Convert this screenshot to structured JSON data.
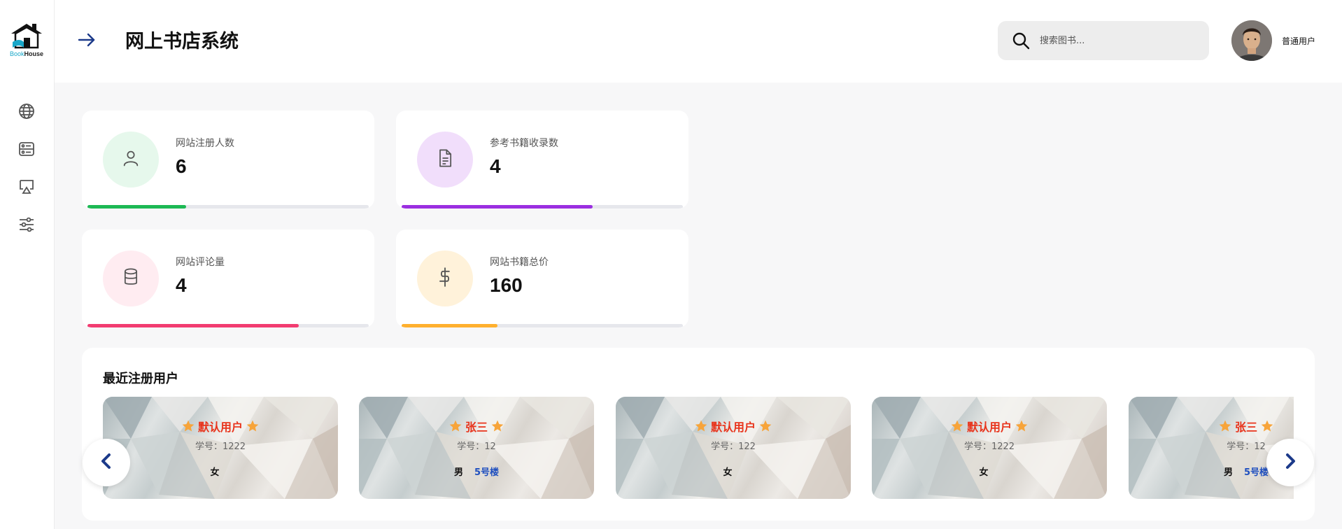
{
  "app": {
    "logo_text_part1": "Book",
    "logo_text_part2": "House"
  },
  "header": {
    "title": "网上书店系统",
    "search_placeholder": "搜索图书...",
    "user_role": "普通用户"
  },
  "sidebar": {
    "items": [
      {
        "icon": "globe-icon"
      },
      {
        "icon": "dashboard-icon"
      },
      {
        "icon": "presentation-icon"
      },
      {
        "icon": "sliders-icon"
      }
    ]
  },
  "stats": [
    {
      "label": "网站注册人数",
      "value": "6",
      "icon": "user-icon",
      "color": "#1db954",
      "bg": "#e6f8ec",
      "progress": 0.35
    },
    {
      "label": "参考书籍收录数",
      "value": "4",
      "icon": "document-icon",
      "color": "#9b2fe0",
      "bg": "#f1defb",
      "progress": 0.68
    },
    {
      "label": "网站评论量",
      "value": "4",
      "icon": "database-icon",
      "color": "#f23c71",
      "bg": "#ffecf1",
      "progress": 0.75
    },
    {
      "label": "网站书籍总价",
      "value": "160",
      "icon": "dollar-icon",
      "color": "#ffb02e",
      "bg": "#fff2da",
      "progress": 0.34
    }
  ],
  "recent_users": {
    "title": "最近注册用户",
    "users": [
      {
        "name": "默认用户",
        "id_label": "学号：1222",
        "gender": "女",
        "dorm": ""
      },
      {
        "name": "张三",
        "id_label": "学号：12",
        "gender": "男",
        "dorm": "5号楼"
      },
      {
        "name": "默认用户",
        "id_label": "学号：122",
        "gender": "女",
        "dorm": ""
      },
      {
        "name": "默认用户",
        "id_label": "学号：1222",
        "gender": "女",
        "dorm": ""
      },
      {
        "name": "张三",
        "id_label": "学号：12",
        "gender": "男",
        "dorm": "5号楼"
      }
    ]
  },
  "colors": {
    "accent": "#1c3a8a",
    "name_red": "#e8341c",
    "star": "#f7a43a"
  }
}
